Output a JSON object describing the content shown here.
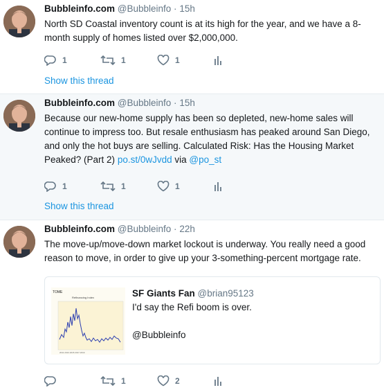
{
  "tweets": [
    {
      "name": "Bubbleinfo.com",
      "handle": "@Bubbleinfo",
      "dot": "·",
      "time": "15h",
      "text_parts": [
        "North SD Coastal inventory count is at its high for the year, and we have a 8-month supply of homes listed over $2,000,000."
      ],
      "replies": "1",
      "retweets": "1",
      "likes": "1",
      "show_thread": "Show this thread"
    },
    {
      "name": "Bubbleinfo.com",
      "handle": "@Bubbleinfo",
      "dot": "·",
      "time": "15h",
      "text_lead": "Because our new-home supply has been so depleted, new-home sales will continue to impress too. But resale enthusiasm has peaked around San Diego, and only the hot buys are selling. Calculated Risk: Has the Housing Market Peaked? (Part 2) ",
      "link1": "po.st/0wJvdd",
      "text_mid": " via ",
      "link2": "@po_st",
      "replies": "1",
      "retweets": "1",
      "likes": "1",
      "show_thread": "Show this thread"
    },
    {
      "name": "Bubbleinfo.com",
      "handle": "@Bubbleinfo",
      "dot": "·",
      "time": "22h",
      "text": "The move-up/move-down market lockout is underway.  You really need a good reason to move, in order to give up your 3-something-percent mortgage rate.",
      "replies": "",
      "retweets": "1",
      "likes": "2",
      "quote": {
        "name": "SF Giants Fan",
        "handle": "@brian95123",
        "text": "I'd say the Refi boom is over.",
        "mention": "@Bubbleinfo",
        "image_title": "Refinancing Index"
      }
    }
  ],
  "icons": {
    "reply": "reply-icon",
    "retweet": "retweet-icon",
    "like": "heart-icon",
    "analytics": "analytics-icon"
  },
  "colors": {
    "link": "#1b95e0",
    "muted": "#657786",
    "highlight_bg": "#f5f8fa"
  }
}
